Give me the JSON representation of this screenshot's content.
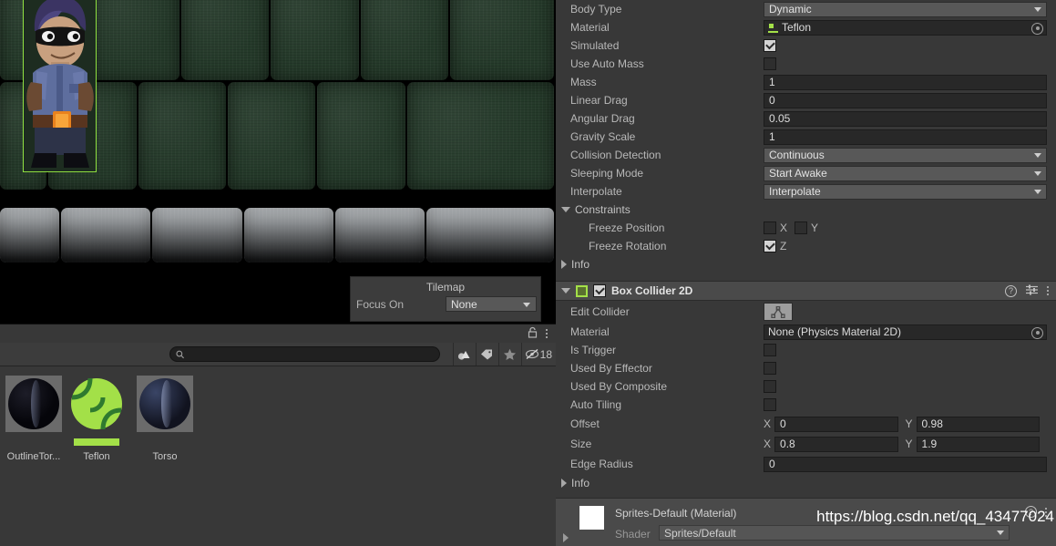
{
  "scene": {
    "tilemap_popup": {
      "title": "Tilemap",
      "focus_label": "Focus On",
      "focus_value": "None"
    },
    "selected_object_outline_color": "#8fe040"
  },
  "project_panel": {
    "search_placeholder": "",
    "search_value": "",
    "hidden_count": "18",
    "assets": [
      {
        "name": "OutlineTor...",
        "type": "material-sphere-dark",
        "selected": false
      },
      {
        "name": "Teflon",
        "type": "material-sphere-green",
        "selected": true
      },
      {
        "name": "Torso",
        "type": "material-sphere-blue",
        "selected": false
      }
    ]
  },
  "inspector": {
    "rigidbody2d": {
      "rows": [
        {
          "label": "Body Type",
          "kind": "dropdown",
          "value": "Dynamic"
        },
        {
          "label": "Material",
          "kind": "object",
          "value": "Teflon"
        },
        {
          "label": "Simulated",
          "kind": "checkbox",
          "value": true
        },
        {
          "label": "Use Auto Mass",
          "kind": "checkbox",
          "value": false
        },
        {
          "label": "Mass",
          "kind": "text",
          "value": "1"
        },
        {
          "label": "Linear Drag",
          "kind": "text",
          "value": "0"
        },
        {
          "label": "Angular Drag",
          "kind": "text",
          "value": "0.05"
        },
        {
          "label": "Gravity Scale",
          "kind": "text",
          "value": "1"
        },
        {
          "label": "Collision Detection",
          "kind": "dropdown",
          "value": "Continuous"
        },
        {
          "label": "Sleeping Mode",
          "kind": "dropdown",
          "value": "Start Awake"
        },
        {
          "label": "Interpolate",
          "kind": "dropdown",
          "value": "Interpolate"
        }
      ],
      "constraints": {
        "label": "Constraints",
        "freeze_position": {
          "label": "Freeze Position",
          "x_label": "X",
          "x": false,
          "y_label": "Y",
          "y": false
        },
        "freeze_rotation": {
          "label": "Freeze Rotation",
          "z_label": "Z",
          "z": true
        }
      },
      "info_label": "Info"
    },
    "box_collider_2d": {
      "title": "Box Collider 2D",
      "enabled": true,
      "edit_collider_label": "Edit Collider",
      "rows": [
        {
          "label": "Material",
          "kind": "object",
          "value": "None (Physics Material 2D)"
        },
        {
          "label": "Is Trigger",
          "kind": "checkbox",
          "value": false
        },
        {
          "label": "Used By Effector",
          "kind": "checkbox",
          "value": false
        },
        {
          "label": "Used By Composite",
          "kind": "checkbox",
          "value": false
        },
        {
          "label": "Auto Tiling",
          "kind": "checkbox",
          "value": false
        }
      ],
      "offset": {
        "label": "Offset",
        "x_label": "X",
        "x": "0",
        "y_label": "Y",
        "y": "0.98"
      },
      "size": {
        "label": "Size",
        "x_label": "X",
        "x": "0.8",
        "y_label": "Y",
        "y": "1.9"
      },
      "edge_radius": {
        "label": "Edge Radius",
        "value": "0"
      },
      "info_label": "Info"
    },
    "material_preview": {
      "name": "Sprites-Default (Material)",
      "shader_label": "Shader",
      "shader_value": "Sprites/Default"
    }
  },
  "watermark": "https://blog.csdn.net/qq_43477024"
}
